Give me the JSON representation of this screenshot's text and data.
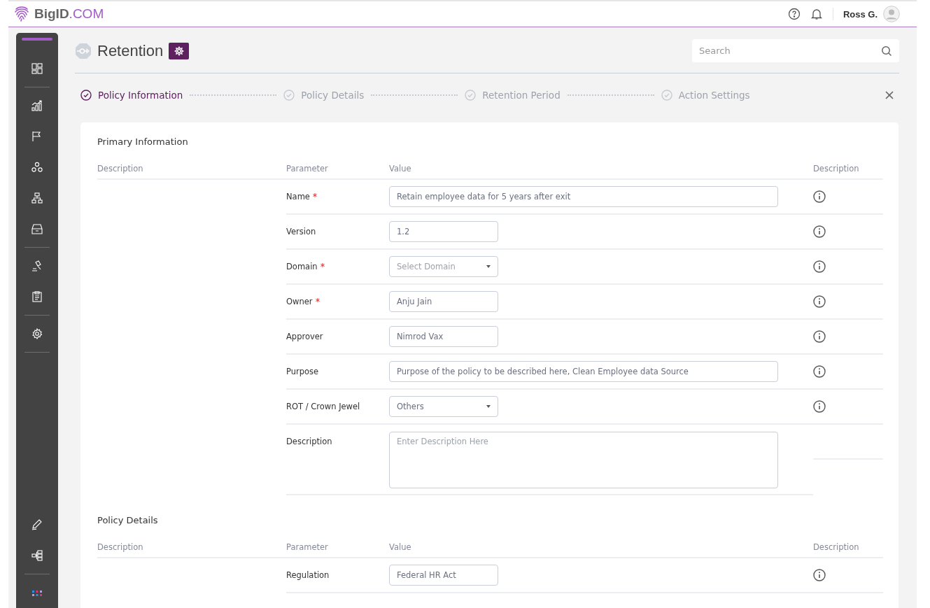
{
  "header": {
    "logo": {
      "name": "BigID",
      "suffix": ".COM"
    },
    "user": "Ross G."
  },
  "page": {
    "title": "Retention",
    "search": {
      "placeholder": "Search"
    }
  },
  "steps": [
    {
      "label": "Policy Information",
      "selected": true
    },
    {
      "label": "Policy Details",
      "selected": false
    },
    {
      "label": "Retention Period",
      "selected": false
    },
    {
      "label": "Action Settings",
      "selected": false
    }
  ],
  "sections": [
    {
      "title": "Primary Information",
      "columns": [
        "Description",
        "Parameter",
        "Value",
        "Description"
      ],
      "rows": [
        {
          "label": "Name",
          "required": true,
          "kind": "longtext",
          "value": "Retain employee data for 5 years after exit",
          "info": true
        },
        {
          "label": "Version",
          "kind": "text",
          "value": "1.2",
          "info": true
        },
        {
          "label": "Domain",
          "required": true,
          "kind": "select",
          "placeholder": "Select Domain",
          "info": true
        },
        {
          "label": "Owner",
          "required": true,
          "kind": "text",
          "value": "Anju Jain",
          "info": true
        },
        {
          "label": "Approver",
          "kind": "text",
          "value": "Nimrod Vax",
          "info": true
        },
        {
          "label": "Purpose",
          "kind": "longtext",
          "value": "Purpose of the policy to be described here, Clean Employee data Source",
          "info": true
        },
        {
          "label": "ROT / Crown Jewel",
          "kind": "select",
          "value": "Others",
          "info": true
        },
        {
          "label": "Description",
          "kind": "textarea",
          "placeholder": "Enter Description Here",
          "info": false
        }
      ]
    },
    {
      "title": "Policy Details",
      "columns": [
        "Description",
        "Parameter",
        "Value",
        "Description"
      ],
      "rows": [
        {
          "label": "Regulation",
          "kind": "text",
          "value": "Federal HR Act",
          "info": true
        }
      ]
    }
  ]
}
